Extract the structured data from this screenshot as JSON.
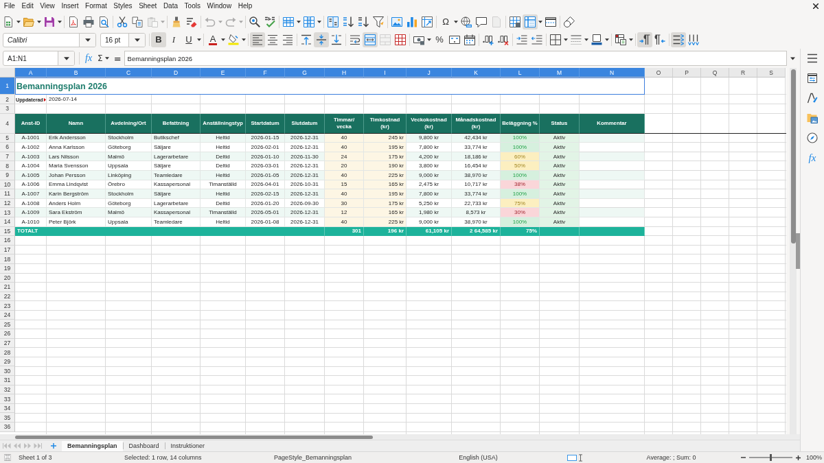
{
  "menu": [
    "File",
    "Edit",
    "View",
    "Insert",
    "Format",
    "Styles",
    "Sheet",
    "Data",
    "Tools",
    "Window",
    "Help"
  ],
  "standard_toolbar": {
    "paste_disabled": true,
    "undo_disabled": true,
    "redo_disabled": true,
    "special_character_label": "Ω",
    "headers_footers_disabled": true,
    "freeze_rows_columns": true
  },
  "formatting_toolbar": {
    "font_name": "Calibri",
    "font_size": "16 pt",
    "text_style": [
      {
        "label": "B",
        "pressed": true
      },
      {
        "label": "I",
        "pressed": false
      },
      {
        "label": "U",
        "pressed": false
      }
    ],
    "font_color": "A",
    "horizontal_align": [
      {
        "selected": true
      },
      {
        "selected": false
      },
      {
        "selected": false
      }
    ],
    "vertical_align": [
      {
        "selected": false
      },
      {
        "selected": true
      },
      {
        "selected": false
      }
    ],
    "merge_and_center": true,
    "merge_cells_disabled": true,
    "percent": "%",
    "paragraph_direction": [
      {
        "selected": true
      },
      {
        "selected": false
      }
    ],
    "text_direction": [
      {
        "selected": true
      },
      {
        "selected": false
      }
    ]
  },
  "formula_bar": {
    "name_box": "A1:N1",
    "function_label": "fx",
    "sum_label": "Σ",
    "equals_label": "=",
    "content": "Bemanningsplan 2026"
  },
  "sidebar": {
    "functions_label": "fx"
  },
  "sheet": {
    "columns": [
      {
        "label": "A",
        "selected": true
      },
      {
        "label": "B",
        "selected": true
      },
      {
        "label": "C",
        "selected": true
      },
      {
        "label": "D",
        "selected": true
      },
      {
        "label": "E",
        "selected": true
      },
      {
        "label": "F",
        "selected": true
      },
      {
        "label": "G",
        "selected": true
      },
      {
        "label": "H",
        "selected": true
      },
      {
        "label": "I",
        "selected": true
      },
      {
        "label": "J",
        "selected": true
      },
      {
        "label": "K",
        "selected": true
      },
      {
        "label": "L",
        "selected": true
      },
      {
        "label": "M",
        "selected": true
      },
      {
        "label": "N",
        "selected": true
      },
      {
        "label": "O",
        "selected": false
      },
      {
        "label": "P",
        "selected": false
      },
      {
        "label": "Q",
        "selected": false
      },
      {
        "label": "R",
        "selected": false
      },
      {
        "label": "S",
        "selected": false
      }
    ],
    "rows": [
      {
        "label": "1",
        "selected": true
      },
      {
        "label": "2",
        "selected": false
      },
      {
        "label": "3",
        "selected": false
      },
      {
        "label": "4",
        "selected": false
      },
      {
        "label": "5",
        "selected": false
      },
      {
        "label": "6",
        "selected": false
      },
      {
        "label": "7",
        "selected": false
      },
      {
        "label": "8",
        "selected": false
      },
      {
        "label": "9",
        "selected": false
      },
      {
        "label": "10",
        "selected": false
      },
      {
        "label": "11",
        "selected": false
      },
      {
        "label": "12",
        "selected": false
      },
      {
        "label": "13",
        "selected": false
      },
      {
        "label": "14",
        "selected": false
      },
      {
        "label": "15",
        "selected": false
      },
      {
        "label": "16",
        "selected": false
      },
      {
        "label": "17",
        "selected": false
      },
      {
        "label": "18",
        "selected": false
      },
      {
        "label": "19",
        "selected": false
      },
      {
        "label": "20",
        "selected": false
      },
      {
        "label": "21",
        "selected": false
      },
      {
        "label": "22",
        "selected": false
      },
      {
        "label": "23",
        "selected": false
      },
      {
        "label": "24",
        "selected": false
      },
      {
        "label": "25",
        "selected": false
      },
      {
        "label": "26",
        "selected": false
      },
      {
        "label": "27",
        "selected": false
      },
      {
        "label": "28",
        "selected": false
      },
      {
        "label": "29",
        "selected": false
      },
      {
        "label": "30",
        "selected": false
      },
      {
        "label": "31",
        "selected": false
      },
      {
        "label": "32",
        "selected": false
      },
      {
        "label": "33",
        "selected": false
      },
      {
        "label": "34",
        "selected": false
      },
      {
        "label": "35",
        "selected": false
      },
      {
        "label": "36",
        "selected": false
      }
    ],
    "title": "Bemanningsplan 2026",
    "updated_label": "Uppdaterad",
    "updated_value": "2026-07-14",
    "headers": [
      "Anst-ID",
      "Namn",
      "Avdelning/Ort",
      "Befattning",
      "Anställningstyp",
      "Startdatum",
      "Slutdatum",
      "Timmar/\nvecka",
      "Timkostnad\n(kr)",
      "Veckokostnad\n(kr)",
      "Månadskostnad\n(kr)",
      "Beläggning %",
      "Status",
      "Kommentar"
    ],
    "employees": [
      {
        "cells": [
          "A-1001",
          "Erik Andersson",
          "Stockholm",
          "Butikschef",
          "Heltid",
          "2026-01-15",
          "2026-12-31",
          "40",
          "245 kr",
          "9,800 kr",
          "42,434 kr",
          "100%",
          "Aktiv"
        ],
        "color": "#d6f0de"
      },
      {
        "cells": [
          "A-1002",
          "Anna Karlsson",
          "Göteborg",
          "Säljare",
          "Heltid",
          "2026-02-01",
          "2026-12-31",
          "40",
          "195 kr",
          "7,800 kr",
          "33,774 kr",
          "100%",
          "Aktiv"
        ],
        "color": "#d6f0de"
      },
      {
        "cells": [
          "A-1003",
          "Lars Nilsson",
          "Malmö",
          "Lagerarbetare",
          "Deltid",
          "2026-01-10",
          "2026-11-30",
          "24",
          "175 kr",
          "4,200 kr",
          "18,186 kr",
          "60%",
          "Aktiv"
        ],
        "color": "#fcefc0"
      },
      {
        "cells": [
          "A-1004",
          "Maria Svensson",
          "Uppsala",
          "Säljare",
          "Deltid",
          "2026-03-01",
          "2026-12-31",
          "20",
          "190 kr",
          "3,800 kr",
          "16,454 kr",
          "50%",
          "Aktiv"
        ],
        "color": "#fcefc0"
      },
      {
        "cells": [
          "A-1005",
          "Johan Persson",
          "Linköping",
          "Teamledare",
          "Heltid",
          "2026-01-05",
          "2026-12-31",
          "40",
          "225 kr",
          "9,000 kr",
          "38,970 kr",
          "100%",
          "Aktiv"
        ],
        "color": "#d6f0de"
      },
      {
        "cells": [
          "A-1006",
          "Emma Lindqvist",
          "Örebro",
          "Kassapersonal",
          "Timanställd",
          "2026-04-01",
          "2026-10-31",
          "15",
          "165 kr",
          "2,475 kr",
          "10,717 kr",
          "38%",
          "Aktiv"
        ],
        "color": "#fad6d9"
      },
      {
        "cells": [
          "A-1007",
          "Karin Bergström",
          "Stockholm",
          "Säljare",
          "Heltid",
          "2026-02-15",
          "2026-12-31",
          "40",
          "195 kr",
          "7,800 kr",
          "33,774 kr",
          "100%",
          "Aktiv"
        ],
        "color": "#d6f0de"
      },
      {
        "cells": [
          "A-1008",
          "Anders Holm",
          "Göteborg",
          "Lagerarbetare",
          "Deltid",
          "2026-01-20",
          "2026-09-30",
          "30",
          "175 kr",
          "5,250 kr",
          "22,733 kr",
          "75%",
          "Aktiv"
        ],
        "color": "#fcefc0"
      },
      {
        "cells": [
          "A-1009",
          "Sara Ekström",
          "Malmö",
          "Kassapersonal",
          "Timanställd",
          "2026-05-01",
          "2026-12-31",
          "12",
          "165 kr",
          "1,980 kr",
          "8,573 kr",
          "30%",
          "Aktiv"
        ],
        "color": "#fad6d9"
      },
      {
        "cells": [
          "A-1010",
          "Peter Björk",
          "Uppsala",
          "Teamledare",
          "Heltid",
          "2026-01-08",
          "2026-12-31",
          "40",
          "225 kr",
          "9,000 kr",
          "38,970 kr",
          "100%",
          "Aktiv"
        ],
        "color": "#d6f0de"
      }
    ],
    "totals": {
      "label": "TOTALT",
      "values": [
        "301",
        "196 kr",
        "61,105 kr",
        "2 64,585 kr",
        "75%"
      ]
    }
  },
  "sheet_tab_bar": {
    "navigation_disabled": true,
    "tabs": [
      {
        "label": "Bemanningsplan",
        "selected": true
      },
      {
        "label": "Dashboard",
        "selected": false
      },
      {
        "label": "Instruktioner",
        "selected": false
      }
    ]
  },
  "status_bar": {
    "sheet": "Sheet 1 of 3",
    "selection": "Selected: 1 row, 14 columns",
    "page_style": "PageStyle_Bemanningsplan",
    "language": "English (USA)",
    "summary": "Average: ; Sum: 0",
    "zoom_slider": {
      "level": 0.5
    },
    "zoom": "100%"
  }
}
